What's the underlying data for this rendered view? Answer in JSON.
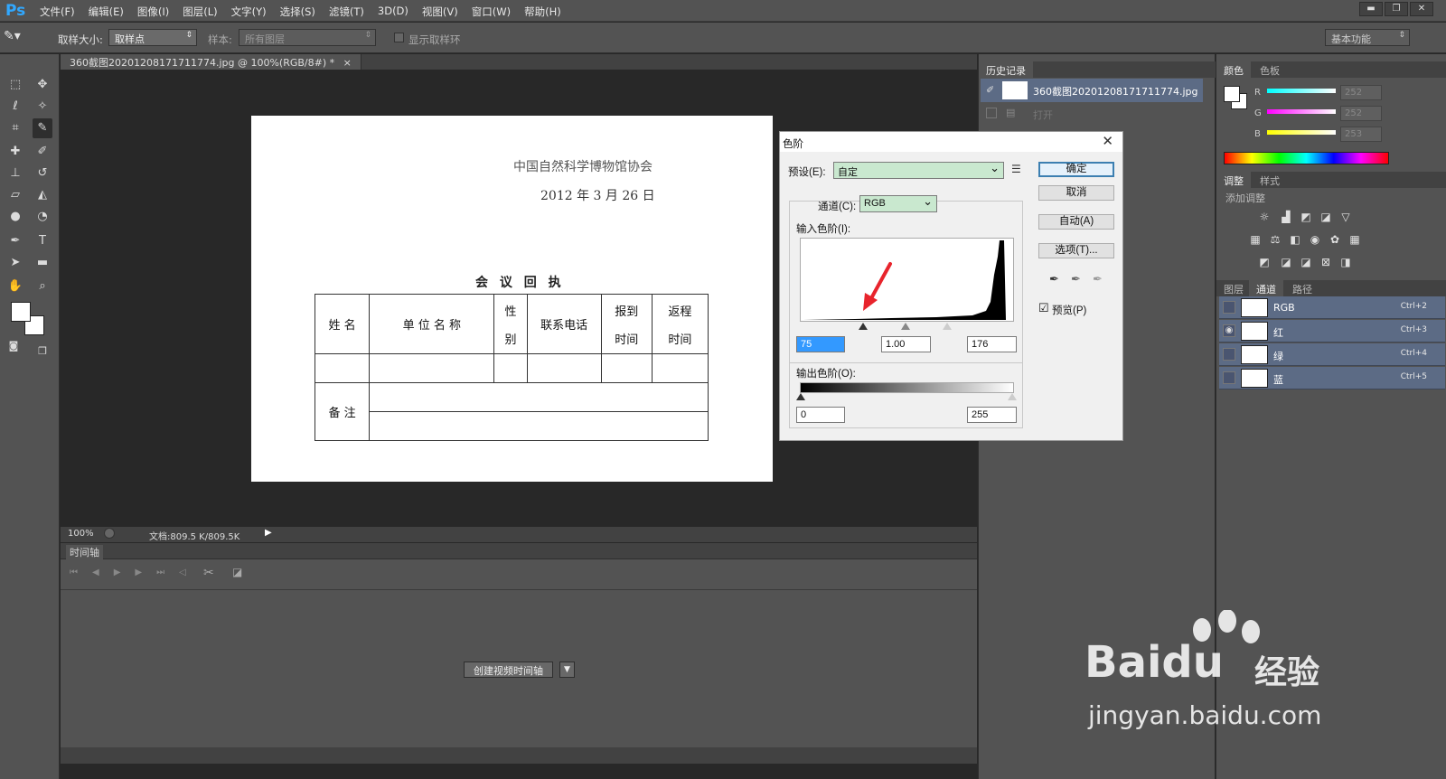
{
  "app": {
    "logo": "Ps"
  },
  "menu": [
    "文件(F)",
    "编辑(E)",
    "图像(I)",
    "图层(L)",
    "文字(Y)",
    "选择(S)",
    "滤镜(T)",
    "3D(D)",
    "视图(V)",
    "窗口(W)",
    "帮助(H)"
  ],
  "window_controls": {
    "minimize": "▬",
    "restore": "❐",
    "close": "✕"
  },
  "options": {
    "sample_size_label": "取样大小:",
    "sample_size_value": "取样点",
    "sample_label": "样本:",
    "sample_value": "所有图层",
    "show_ring_label": "显示取样环",
    "workspace": "基本功能"
  },
  "document": {
    "tab_title": "360截图20201208171711774.jpg @ 100%(RGB/8#) *",
    "tab_close": "×",
    "org_name": "中国自然科学博物馆协会",
    "date": "2012 年 3 月 26 日",
    "form_title": "会 议 回 执",
    "headers": {
      "name": "姓 名",
      "unit": "单 位 名 称",
      "gender_1": "性",
      "gender_2": "别",
      "phone": "联系电话",
      "arrive_1": "报到",
      "arrive_2": "时间",
      "return_1": "返程",
      "return_2": "时间"
    },
    "remark": "备 注"
  },
  "status": {
    "zoom": "100%",
    "doc_info": "文档:809.5 K/809.5K"
  },
  "timeline": {
    "title": "时间轴",
    "create_button": "创建视频时间轴"
  },
  "history_panel": {
    "tab": "历史记录",
    "snapshot_name": "360截图20201208171711774.jpg",
    "step_open": "打开"
  },
  "color_panel": {
    "tabs": [
      "颜色",
      "色板"
    ],
    "channels": [
      {
        "label": "R",
        "value": "252"
      },
      {
        "label": "G",
        "value": "252"
      },
      {
        "label": "B",
        "value": "253"
      }
    ]
  },
  "adjust_panel": {
    "tabs": [
      "调整",
      "样式"
    ],
    "add_label": "添加调整"
  },
  "channels_panel": {
    "tabs": [
      "图层",
      "通道",
      "路径"
    ],
    "channels": [
      {
        "name": "RGB",
        "shortcut": "Ctrl+2"
      },
      {
        "name": "红",
        "shortcut": "Ctrl+3"
      },
      {
        "name": "绿",
        "shortcut": "Ctrl+4"
      },
      {
        "name": "蓝",
        "shortcut": "Ctrl+5"
      }
    ]
  },
  "levels_dialog": {
    "title": "色阶",
    "close": "✕",
    "preset_label": "预设(E):",
    "preset_value": "自定",
    "channel_label": "通道(C):",
    "channel_value": "RGB",
    "input_label": "输入色阶(I):",
    "input_black": "75",
    "input_gamma": "1.00",
    "input_white": "176",
    "output_label": "输出色阶(O):",
    "output_black": "0",
    "output_white": "255",
    "buttons": {
      "ok": "确定",
      "cancel": "取消",
      "auto": "自动(A)",
      "options": "选项(T)..."
    },
    "preview_label": "预览(P)",
    "preview_checked": "☑"
  },
  "watermark": {
    "brand": "Baidu",
    "cn": "经验",
    "url": "jingyan.baidu.com"
  }
}
